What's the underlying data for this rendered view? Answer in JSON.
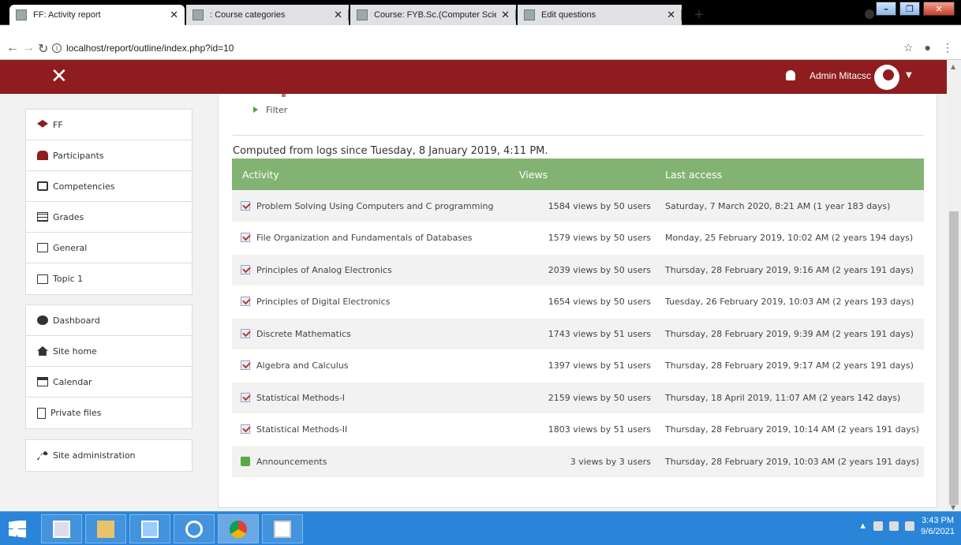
{
  "browser": {
    "tabs": [
      {
        "title": "FF: Activity report",
        "active": true
      },
      {
        "title": ": Course categories",
        "active": false
      },
      {
        "title": "Course: FYB.Sc.(Computer Scienc",
        "active": false
      },
      {
        "title": "Edit questions",
        "active": false
      }
    ],
    "new_tab": "+",
    "url": "localhost/report/outline/index.php?id=10"
  },
  "navbar": {
    "user_name": "Admin Mitacsc"
  },
  "sidebar": {
    "course_items": [
      {
        "label": "FF",
        "icon": "graduation-cap-icon"
      },
      {
        "label": "Participants",
        "icon": "users-icon"
      },
      {
        "label": "Competencies",
        "icon": "check-square-icon"
      },
      {
        "label": "Grades",
        "icon": "table-icon"
      },
      {
        "label": "General",
        "icon": "folder-icon"
      },
      {
        "label": "Topic 1",
        "icon": "folder-icon"
      }
    ],
    "site_items": [
      {
        "label": "Dashboard",
        "icon": "dashboard-icon"
      },
      {
        "label": "Site home",
        "icon": "home-icon"
      },
      {
        "label": "Calendar",
        "icon": "calendar-icon"
      },
      {
        "label": "Private files",
        "icon": "file-icon"
      }
    ],
    "admin_items": [
      {
        "label": "Site administration",
        "icon": "wrench-icon"
      }
    ]
  },
  "main": {
    "filter_label": "Filter",
    "computed_text": "Computed from logs since Tuesday, 8 January 2019, 4:11 PM.",
    "table": {
      "headers": {
        "activity": "Activity",
        "views": "Views",
        "last_access": "Last access"
      },
      "rows": [
        {
          "activity": "Problem Solving Using Computers and C programming",
          "views": "1584 views by 50 users",
          "last_access": "Saturday, 7 March 2020, 8:21 AM (1 year 183 days)",
          "type": "quiz"
        },
        {
          "activity": "File Organization and Fundamentals of Databases",
          "views": "1579 views by 50 users",
          "last_access": "Monday, 25 February 2019, 10:02 AM (2 years 194 days)",
          "type": "quiz"
        },
        {
          "activity": "Principles of Analog Electronics",
          "views": "2039 views by 50 users",
          "last_access": "Thursday, 28 February 2019, 9:16 AM (2 years 191 days)",
          "type": "quiz"
        },
        {
          "activity": "Principles of Digital Electronics",
          "views": "1654 views by 50 users",
          "last_access": "Tuesday, 26 February 2019, 10:03 AM (2 years 193 days)",
          "type": "quiz"
        },
        {
          "activity": "Discrete Mathematics",
          "views": "1743 views by 51 users",
          "last_access": "Thursday, 28 February 2019, 9:39 AM (2 years 191 days)",
          "type": "quiz"
        },
        {
          "activity": "Algebra and Calculus",
          "views": "1397 views by 51 users",
          "last_access": "Thursday, 28 February 2019, 9:17 AM (2 years 191 days)",
          "type": "quiz"
        },
        {
          "activity": "Statistical Methods-I",
          "views": "2159 views by 50 users",
          "last_access": "Thursday, 18 April 2019, 11:07 AM (2 years 142 days)",
          "type": "quiz"
        },
        {
          "activity": "Statistical Methods-II",
          "views": "1803 views by 51 users",
          "last_access": "Thursday, 28 February 2019, 10:14 AM (2 years 191 days)",
          "type": "quiz"
        },
        {
          "activity": "Announcements",
          "views": "3 views by 3 users",
          "last_access": "Thursday, 28 February 2019, 10:03 AM (2 years 191 days)",
          "type": "forum"
        }
      ]
    }
  },
  "taskbar": {
    "time": "3:43 PM",
    "date": "9/6/2021"
  },
  "colors": {
    "brand_red": "#8f1d1f",
    "table_header_green": "#83b373",
    "taskbar_blue": "#2a85d9"
  }
}
